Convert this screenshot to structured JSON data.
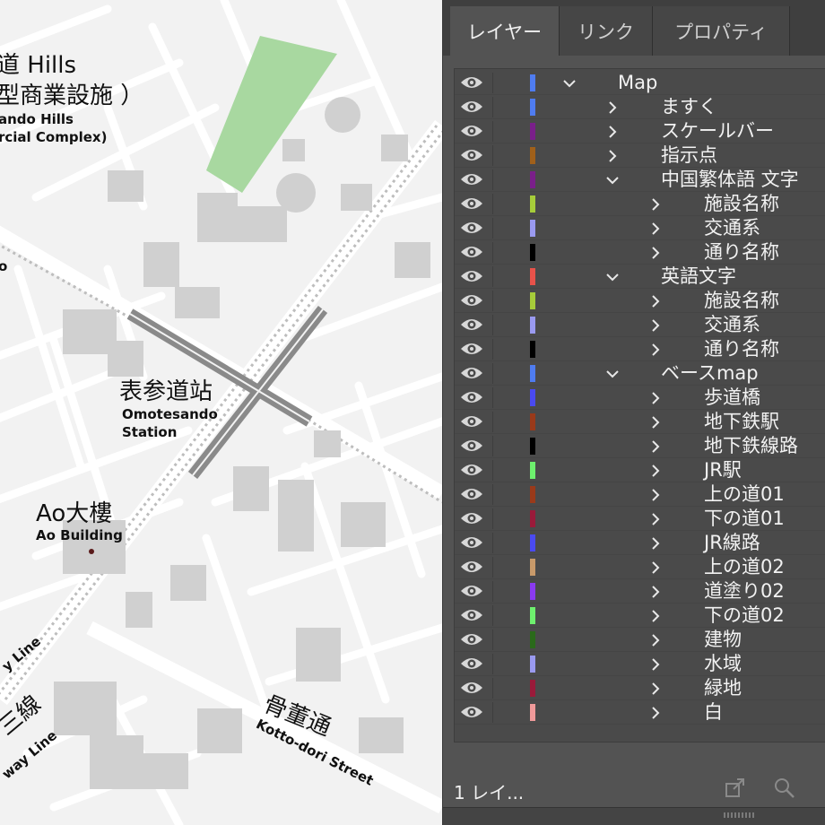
{
  "map": {
    "labels": {
      "hills_ja_1": "道 Hills",
      "hills_ja_2": "型商業設施 ）",
      "hills_en_1": "ando Hills",
      "hills_en_2": "rcial Complex)",
      "station_ja": "表参道站",
      "station_en_1": "Omotesando",
      "station_en_2": "Station",
      "ao_ja": "Ao大樓",
      "ao_en": "Ao Building",
      "street_ja": "骨董通",
      "street_en": "Kotto-dori Street",
      "left_ja": "三線",
      "left_en_1": "y Line",
      "left_en_2": "way Line",
      "left_o": "o"
    }
  },
  "panel": {
    "tabs": [
      {
        "label": "レイヤー",
        "active": true
      },
      {
        "label": "リンク",
        "active": false
      },
      {
        "label": "プロパティ",
        "active": false
      }
    ],
    "layers": [
      {
        "name": "Map",
        "level": 0,
        "expanded": true,
        "color": "#4f7cf0"
      },
      {
        "name": "ますく",
        "level": 1,
        "expanded": false,
        "color": "#4f7cf0"
      },
      {
        "name": "スケールバー",
        "level": 1,
        "expanded": false,
        "color": "#7a1f8a"
      },
      {
        "name": "指示点",
        "level": 1,
        "expanded": false,
        "color": "#a0601a"
      },
      {
        "name": "中国繁体語 文字",
        "level": 1,
        "expanded": true,
        "color": "#7a1f8a"
      },
      {
        "name": "施設名称",
        "level": 2,
        "expanded": false,
        "color": "#a6cc3a"
      },
      {
        "name": "交通系",
        "level": 2,
        "expanded": false,
        "color": "#9a9af0"
      },
      {
        "name": "通り名称",
        "level": 2,
        "expanded": false,
        "color": "#000000"
      },
      {
        "name": "英語文字",
        "level": 1,
        "expanded": true,
        "color": "#e8524a"
      },
      {
        "name": "施設名称",
        "level": 2,
        "expanded": false,
        "color": "#a6cc3a"
      },
      {
        "name": "交通系",
        "level": 2,
        "expanded": false,
        "color": "#9a9af0"
      },
      {
        "name": "通り名称",
        "level": 2,
        "expanded": false,
        "color": "#000000"
      },
      {
        "name": "ベースmap",
        "level": 1,
        "expanded": true,
        "color": "#4f7cf0"
      },
      {
        "name": "歩道橋",
        "level": 2,
        "expanded": false,
        "color": "#4a4af0"
      },
      {
        "name": "地下鉄駅",
        "level": 2,
        "expanded": false,
        "color": "#9a3a1a"
      },
      {
        "name": "地下鉄線路",
        "level": 2,
        "expanded": false,
        "color": "#000000"
      },
      {
        "name": "JR駅",
        "level": 2,
        "expanded": false,
        "color": "#6ef06e"
      },
      {
        "name": "上の道01",
        "level": 2,
        "expanded": false,
        "color": "#9a3a1a"
      },
      {
        "name": "下の道01",
        "level": 2,
        "expanded": false,
        "color": "#9a1a3a"
      },
      {
        "name": "JR線路",
        "level": 2,
        "expanded": false,
        "color": "#4a4af0"
      },
      {
        "name": "上の道02",
        "level": 2,
        "expanded": false,
        "color": "#c89a6a"
      },
      {
        "name": "道塗り02",
        "level": 2,
        "expanded": false,
        "color": "#8a3af0"
      },
      {
        "name": "下の道02",
        "level": 2,
        "expanded": false,
        "color": "#6ef06e"
      },
      {
        "name": "建物",
        "level": 2,
        "expanded": false,
        "color": "#2a6a1a"
      },
      {
        "name": "水域",
        "level": 2,
        "expanded": false,
        "color": "#9a9af0"
      },
      {
        "name": "緑地",
        "level": 2,
        "expanded": false,
        "color": "#9a1a3a"
      },
      {
        "name": "白",
        "level": 2,
        "expanded": false,
        "color": "#f09a9a"
      }
    ],
    "footer": {
      "count_label": "1 レイ...",
      "icons": [
        "export-icon",
        "search-icon"
      ]
    }
  }
}
